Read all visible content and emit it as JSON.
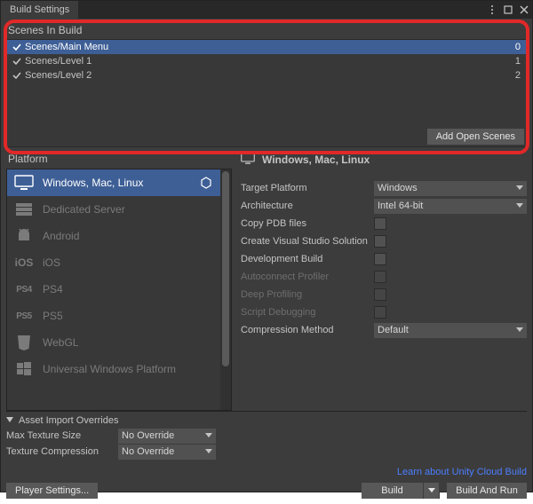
{
  "titlebar": {
    "title": "Build Settings"
  },
  "scenes": {
    "header": "Scenes In Build",
    "items": [
      {
        "name": "Scenes/Main Menu",
        "index": "0",
        "selected": true
      },
      {
        "name": "Scenes/Level 1",
        "index": "1",
        "selected": false
      },
      {
        "name": "Scenes/Level 2",
        "index": "2",
        "selected": false
      }
    ],
    "add_open_label": "Add Open Scenes"
  },
  "platforms": {
    "header": "Platform",
    "items": [
      {
        "label": "Windows, Mac, Linux",
        "icon": "desktop",
        "active": true,
        "current": true
      },
      {
        "label": "Dedicated Server",
        "icon": "server",
        "active": false
      },
      {
        "label": "Android",
        "icon": "android",
        "active": false
      },
      {
        "label": "iOS",
        "icon": "ios",
        "active": false
      },
      {
        "label": "PS4",
        "icon": "ps4",
        "active": false
      },
      {
        "label": "PS5",
        "icon": "ps5",
        "active": false
      },
      {
        "label": "WebGL",
        "icon": "html5",
        "active": false
      },
      {
        "label": "Universal Windows Platform",
        "icon": "uwp",
        "active": false
      }
    ]
  },
  "settings": {
    "header": "Windows, Mac, Linux",
    "target_platform": {
      "label": "Target Platform",
      "value": "Windows"
    },
    "architecture": {
      "label": "Architecture",
      "value": "Intel 64-bit"
    },
    "copy_pdb": {
      "label": "Copy PDB files"
    },
    "create_vs": {
      "label": "Create Visual Studio Solution"
    },
    "dev_build": {
      "label": "Development Build"
    },
    "autoconnect": {
      "label": "Autoconnect Profiler"
    },
    "deep_profiling": {
      "label": "Deep Profiling"
    },
    "script_debug": {
      "label": "Script Debugging"
    },
    "compression": {
      "label": "Compression Method",
      "value": "Default"
    }
  },
  "asset_overrides": {
    "header": "Asset Import Overrides",
    "max_texture": {
      "label": "Max Texture Size",
      "value": "No Override"
    },
    "tex_compression": {
      "label": "Texture Compression",
      "value": "No Override"
    }
  },
  "learn_link": "Learn about Unity Cloud Build",
  "footer": {
    "player_settings": "Player Settings...",
    "build": "Build",
    "build_and_run": "Build And Run"
  }
}
